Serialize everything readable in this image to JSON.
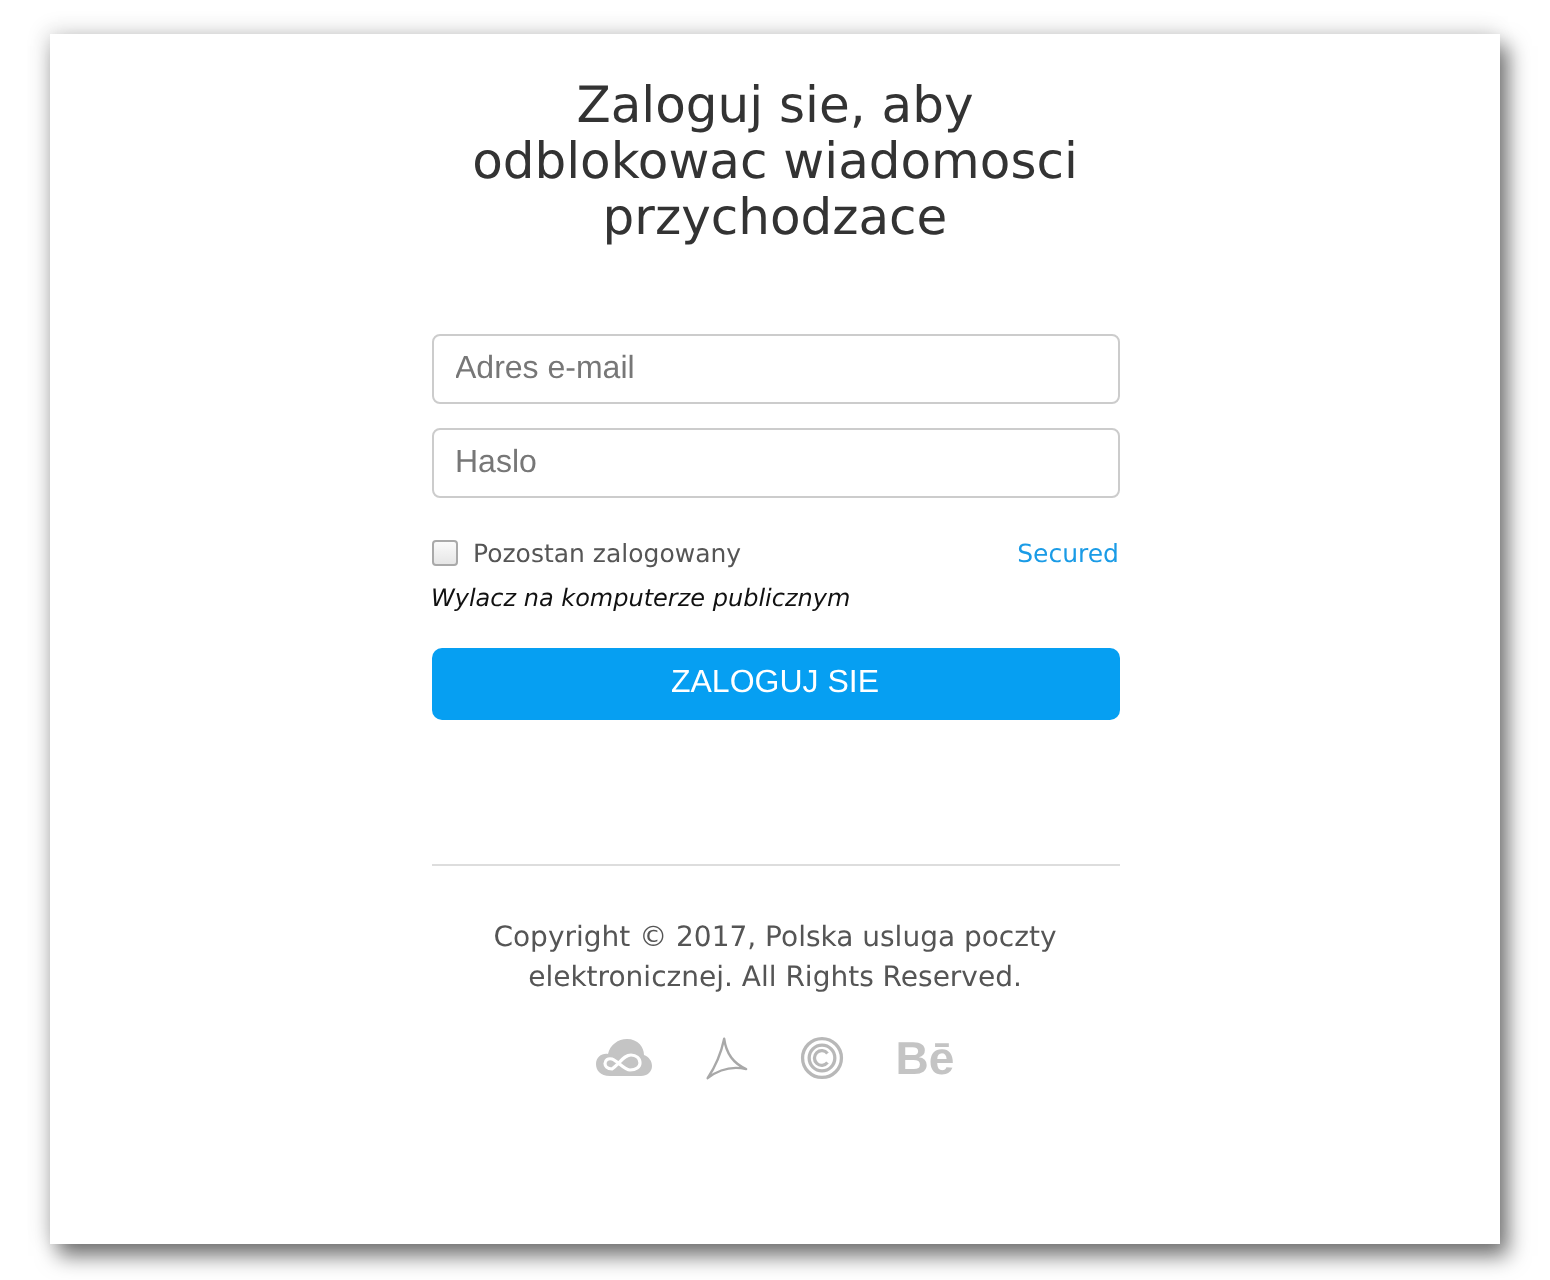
{
  "title": "Zaloguj sie, aby odblokowac wiadomosci przychodzace",
  "form": {
    "email": {
      "placeholder": "Adres e-mail"
    },
    "password": {
      "placeholder": "Haslo"
    },
    "remember_me": {
      "label": "Pozostan zalogowany",
      "checked": false
    },
    "secured_link": "Secured",
    "hint": "Wylacz na komputerze publicznym",
    "submit": "ZALOGUJ SIE"
  },
  "footer": {
    "copyright": "Copyright © 2017, Polska usluga poczty elektronicznej. All Rights Reserved.",
    "icons": [
      {
        "kind": "cloud"
      },
      {
        "kind": "swirl"
      },
      {
        "kind": "rings"
      },
      {
        "kind": "text",
        "text": "Bē"
      }
    ]
  }
}
